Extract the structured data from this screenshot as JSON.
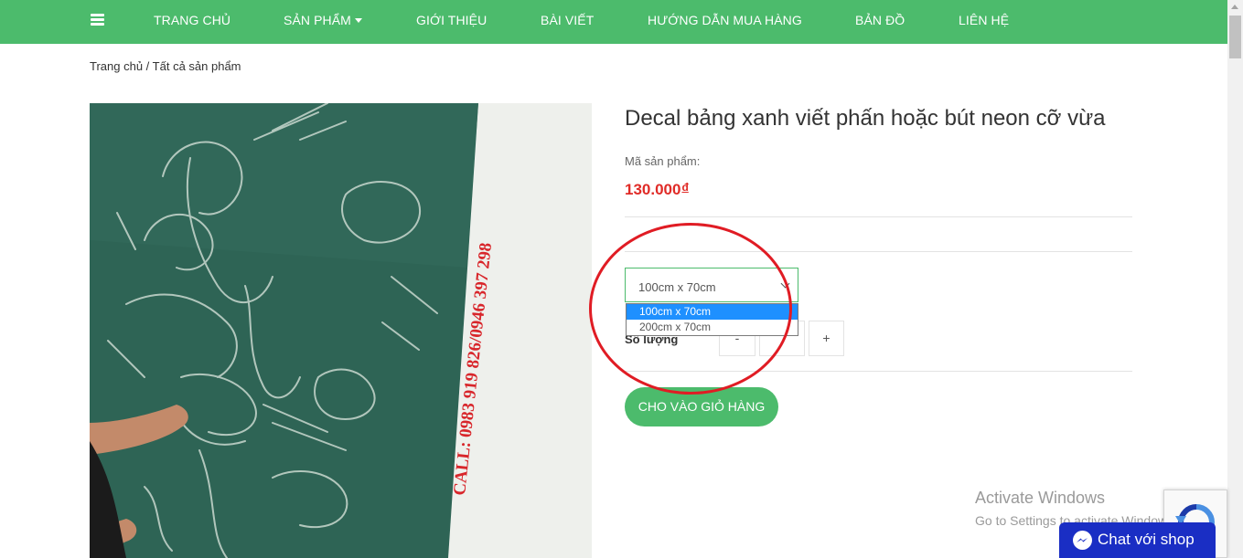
{
  "nav": {
    "items": [
      {
        "label": "TRANG CHỦ"
      },
      {
        "label": "SẢN PHẨM"
      },
      {
        "label": "GIỚI THIỆU"
      },
      {
        "label": "BÀI VIẾT"
      },
      {
        "label": "HƯỚNG DẪN MUA HÀNG"
      },
      {
        "label": "BẢN ĐỒ"
      },
      {
        "label": "LIÊN HỆ"
      }
    ]
  },
  "breadcrumb": {
    "home": "Trang chủ",
    "separator": " / ",
    "current": "Tất cả sản phẩm"
  },
  "product": {
    "image_text": "CALL: 0983 919 826/0946 397 298",
    "title": "Decal bảng xanh viết phấn hoặc bút neon cỡ vừa",
    "sku_label": "Mã sản phẩm:",
    "price": "130.000",
    "currency": "đ",
    "variant_selected": "100cm x 70cm",
    "variant_options": [
      "100cm x 70cm",
      "200cm x 70cm"
    ],
    "qty_label": "Số lượng",
    "qty_minus": "-",
    "qty_plus": "+",
    "qty_value": "",
    "add_to_cart": "CHO VÀO GIỎ HÀNG"
  },
  "overlay": {
    "windows_l1": "Activate Windows",
    "windows_l2": "Go to Settings to activate Windows.",
    "chat_label": "Chat với shop"
  },
  "colors": {
    "nav_bg": "#4cbb6c",
    "price": "#e02b27",
    "annotation_circle": "#e01c24",
    "dropdown_highlight": "#1e90ff",
    "chat_bg": "#1a2ec4"
  }
}
